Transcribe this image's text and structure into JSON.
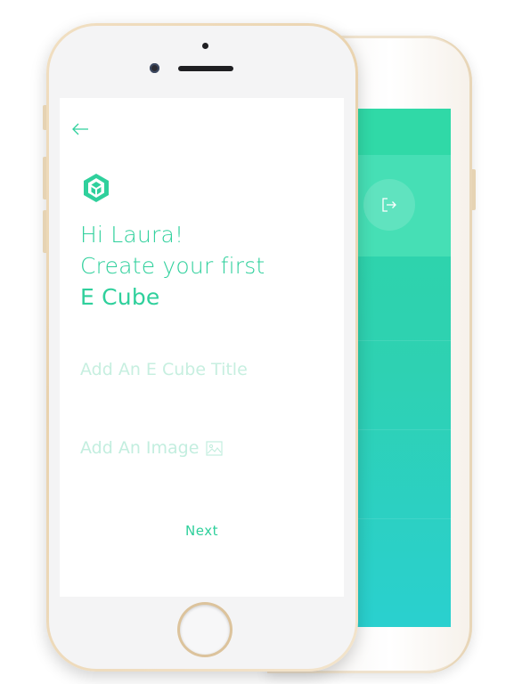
{
  "colors": {
    "accent": "#2fd09c",
    "placeholder": "#c7efe0",
    "back_screen_top": "#2fd6a6",
    "back_screen_bottom": "#2ad0cf",
    "phone_gold": "#e9d2ad"
  },
  "nav": {
    "back_icon": "arrow-left-icon"
  },
  "brand": {
    "logo_icon": "e-cube-logo-icon"
  },
  "greeting": {
    "line1": "Hi Laura!",
    "line2": "Create your first",
    "line3": "E Cube"
  },
  "form": {
    "title_placeholder": "Add An E Cube Title",
    "title_value": "",
    "image_label": "Add An Image",
    "image_icon": "image-icon"
  },
  "actions": {
    "next_label": "Next"
  },
  "back_phone": {
    "exit_icon": "exit-icon"
  }
}
